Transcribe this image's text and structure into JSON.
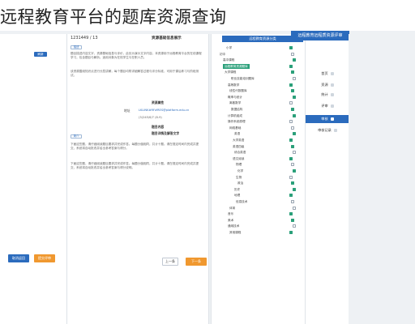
{
  "caption": "远程教育平台的题库资源查询",
  "app": {
    "badge": "远程教育远程质资源评审"
  },
  "left": {
    "pill": "刷新"
  },
  "doc": {
    "id": "1231449 / 13",
    "heading": "资源基础信息展示",
    "tag1": "描述",
    "tag2": "简介",
    "para1": "题目描述内容文字，资源基础信息与评价，此处为演示文字内容。本资源用于远程教育平台的在线课程学习，包含题目与解析。适用对象为在校学生与在职人员。",
    "para2": "该资源围绕知识点进行分层讲解，每个题目均附详细解答过程与评分标准，可用于课后练习与阶段测试。",
    "link_label": "地址",
    "link_text": "LKLINK#RF#RES@platform.edu.cn",
    "meta_text": "(3)245/6/7 (8-9)",
    "section1": "资源属性",
    "section2": "题目内容",
    "section3": "题目详情及解答文字",
    "para3": "下面这些题，请仔细阅读题目要求并完成作答。每题分值相同，共计十题。请在规定时间内完成并提交，系统将自动批改并给出参考答案与得分。",
    "para4": "下面这些题，请仔细阅读题目要求并完成作答。每题分值相同，共计十题。请在规定时间内完成并提交，系统将自动批改并给出参考答案与得分说明。"
  },
  "panel": {
    "header": "远程教育资源分类",
    "rows": [
      "小学",
      "初中",
      "高中课程",
      "远程教育资源题库",
      "大学课程",
      "职业技能培训题库",
      "高等数学",
      "线性代数题库",
      "概率与统计",
      "离散数学",
      "数据结构",
      "计算机组成",
      "操作系统原理",
      "网络基础",
      "英语",
      "大学英语",
      "英语四级",
      "综合英语",
      "语文阅读",
      "物理",
      "化学",
      "生物",
      "政治",
      "历史",
      "地理",
      "信息技术",
      "体育",
      "音乐",
      "美术",
      "通用技术",
      "其他课程"
    ]
  },
  "sidebar": {
    "items": [
      "首页",
      "资源",
      "统计",
      "评审",
      "审核",
      "审核记录"
    ]
  },
  "buttons": {
    "cancel": "取消返回",
    "submit": "提交评审",
    "prev": "上一条",
    "next": "下一条"
  }
}
